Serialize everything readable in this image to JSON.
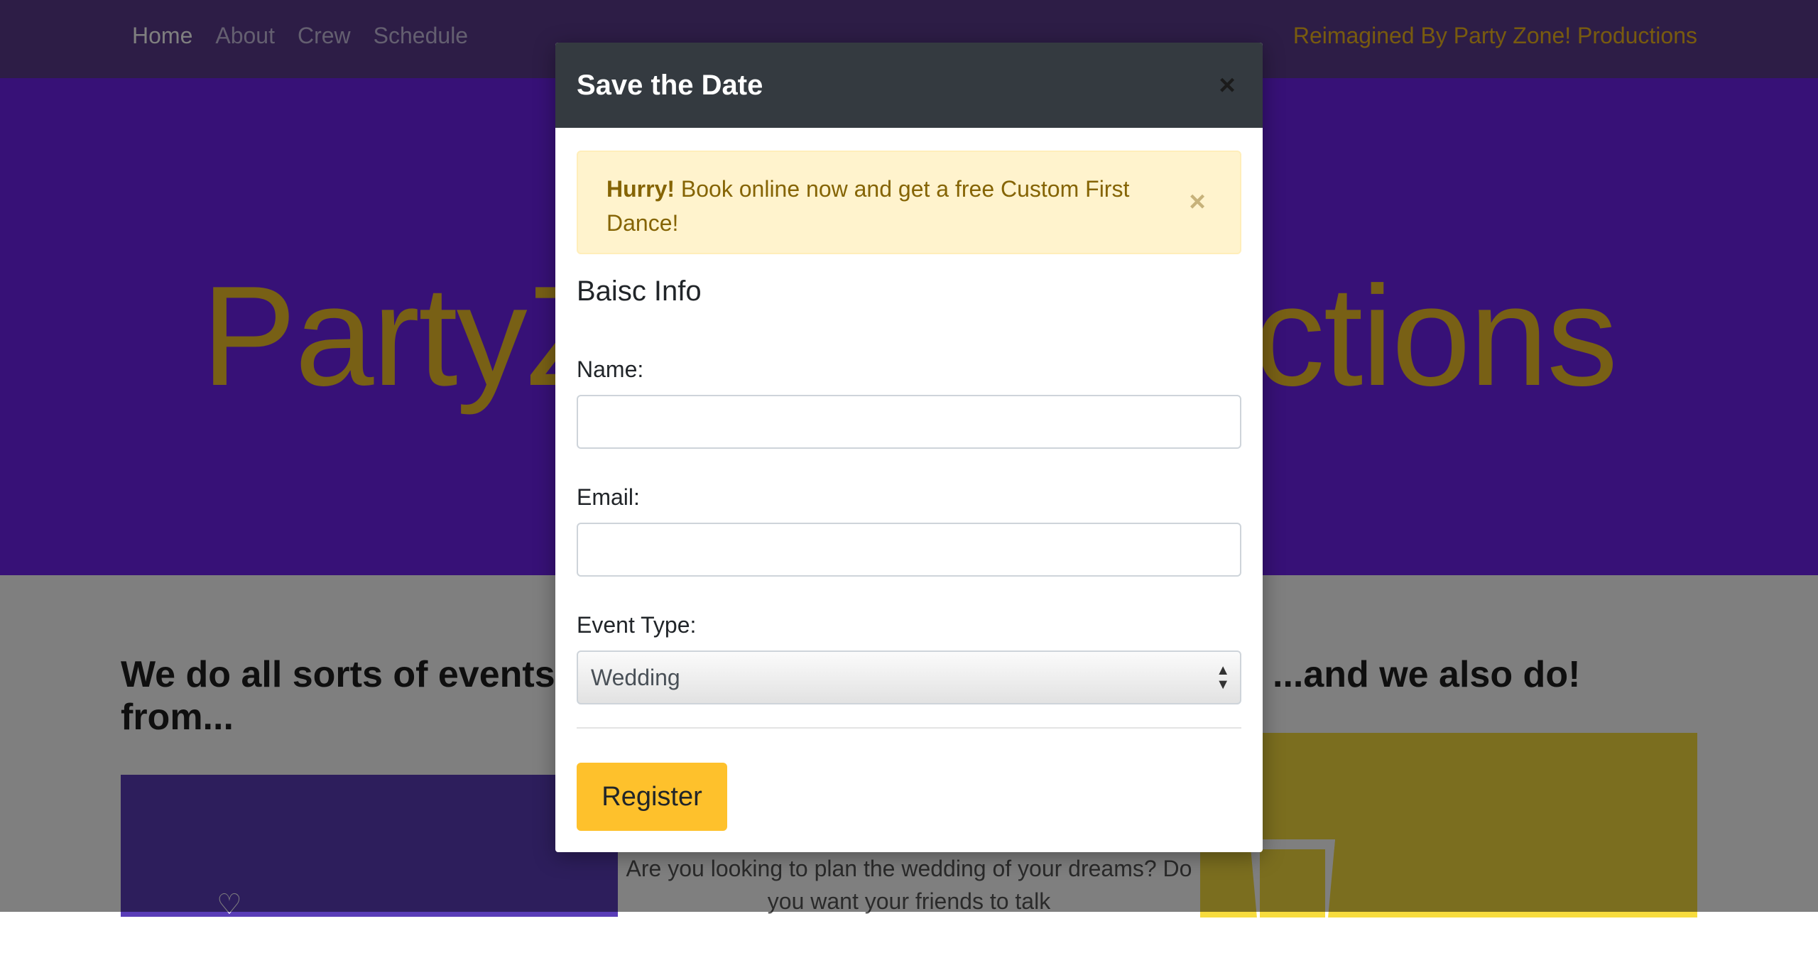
{
  "nav": {
    "links": [
      {
        "label": "Home",
        "active": true
      },
      {
        "label": "About",
        "active": false
      },
      {
        "label": "Crew",
        "active": false
      },
      {
        "label": "Schedule",
        "active": false
      }
    ],
    "brand": "Reimagined By Party Zone! Productions"
  },
  "hero": {
    "title": "PartyZone Productions"
  },
  "content": {
    "events_heading": "We do all sorts of events from...",
    "also_heading": "...and we also do!",
    "card_text": "Are you looking to plan the wedding of your dreams? Do you want your friends to talk"
  },
  "modal": {
    "title": "Save the Date",
    "close_symbol": "×",
    "alert": {
      "strong": "Hurry!",
      "text": " Book online now and get a free Custom First Dance!",
      "close_symbol": "×"
    },
    "section_title": "Baisc Info",
    "name_label": "Name:",
    "name_value": "",
    "email_label": "Email:",
    "email_value": "",
    "event_type_label": "Event Type:",
    "event_type_selected": "Wedding",
    "register_label": "Register"
  },
  "colors": {
    "nav_bg": "#5b3a8c",
    "hero_bg": "#6f23ee",
    "hero_title": "#f1c02a",
    "modal_header_bg": "#343a40",
    "alert_bg": "#fff3cd",
    "alert_text": "#856404",
    "register_bg": "#fec12c"
  },
  "icons": [
    "close-icon",
    "alert-close-icon",
    "select-arrows-icon",
    "heart-icon",
    "glass-icon"
  ]
}
